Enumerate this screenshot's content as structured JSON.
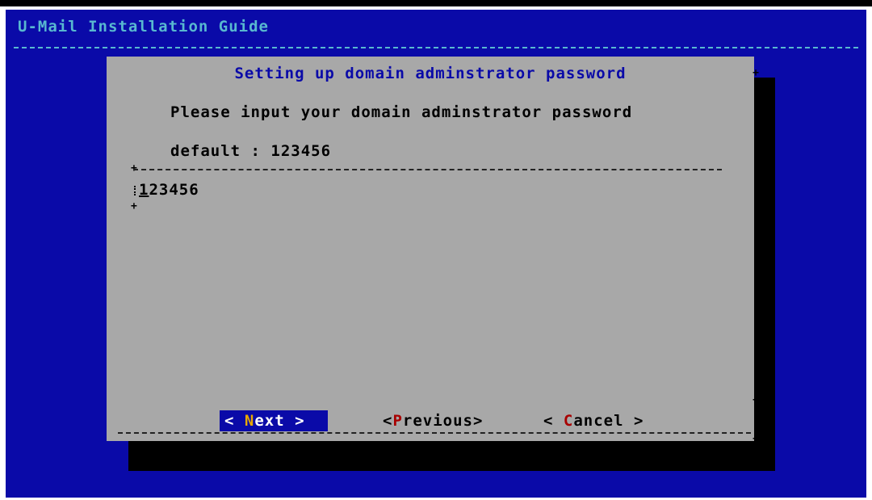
{
  "backtitle": "U-Mail Installation Guide",
  "dialog": {
    "title": "Setting up domain adminstrator password",
    "message": "Please input your domain adminstrator password",
    "default_line": "default : 123456",
    "input": {
      "value_first_char": "1",
      "value_rest": "23456"
    },
    "buttons": {
      "next": {
        "left": "< ",
        "hot": "N",
        "rest": "ext",
        "right": " >"
      },
      "previous": {
        "left": "<",
        "hot": "P",
        "rest": "revious",
        "right": ">"
      },
      "cancel": {
        "left": "< ",
        "hot": "C",
        "rest": "ancel",
        "right": " >"
      }
    }
  },
  "colors": {
    "background": "#0a0aa8",
    "dialog": "#a8a8a8",
    "shadow": "#000000",
    "title": "#0a0aa8",
    "hotkey": "#a80000",
    "selected_hotkey": "#e8a800",
    "backtitle": "#58b8d0"
  }
}
